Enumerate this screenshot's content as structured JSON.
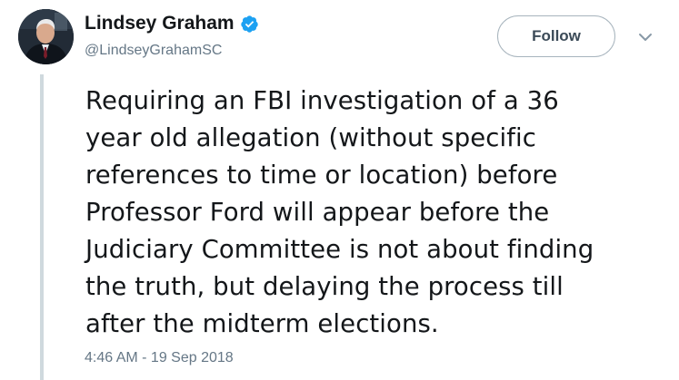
{
  "tweet": {
    "author": {
      "display_name": "Lindsey Graham",
      "handle": "@LindseyGrahamSC",
      "verified": true,
      "avatar_icon": "profile-photo-icon"
    },
    "follow_label": "Follow",
    "menu_icon": "chevron-down-icon",
    "text": "Requiring an FBI investigation of a 36\nyear old allegation (without specific\nreferences to time or location) before\nProfessor Ford will appear before the\nJudiciary Committee is not about finding\nthe truth, but delaying the process till\nafter the midterm elections.",
    "timestamp": "4:46 AM - 19 Sep 2018"
  },
  "colors": {
    "verified_badge": "#1da1f2",
    "secondary_text": "#657786",
    "primary_text": "#14171a",
    "thread_line": "#cfd9de"
  }
}
